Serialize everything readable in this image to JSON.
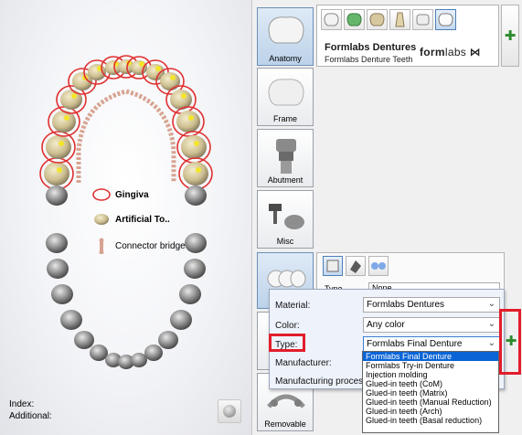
{
  "arch": {
    "legend": [
      {
        "label": "Gingiva",
        "icon": "gingiva-ring-icon",
        "bold": true
      },
      {
        "label": "Artificial To..",
        "icon": "artificial-tooth-icon",
        "bold": true
      },
      {
        "label": "Connector bridge",
        "icon": "connector-bridge-icon",
        "bold": false
      }
    ],
    "index_label": "Index:",
    "additional_label": "Additional:",
    "view_icon": "view-toggle-icon"
  },
  "categories": [
    {
      "label": "Anatomy",
      "icon": "anatomy-tooth-icon",
      "active": true
    },
    {
      "label": "Frame",
      "icon": "frame-tooth-icon",
      "active": false
    },
    {
      "label": "Abutment",
      "icon": "abutment-icon",
      "active": false
    },
    {
      "label": "Misc",
      "icon": "misc-icon",
      "active": false
    },
    {
      "label": "",
      "icon": "denture-teeth-icon",
      "active": true
    },
    {
      "label": "",
      "icon": "partial-icon",
      "active": false
    },
    {
      "label": "Removable",
      "icon": "removable-icon",
      "active": false
    }
  ],
  "material": {
    "product_name": "Formlabs Dentures",
    "product_sub": "Formlabs Denture Teeth",
    "brand_bold": "form",
    "brand_thin": "labs",
    "tooth_types": [
      "molar-icon",
      "green-tooth-icon",
      "premolar-icon",
      "incisor-icon",
      "crown-icon",
      "denture-set-icon"
    ]
  },
  "removable": {
    "type_label": "Type",
    "type_value": "None"
  },
  "popup": {
    "material_label": "Material:",
    "material_value": "Formlabs Dentures",
    "color_label": "Color:",
    "color_value": "Any color",
    "type_label": "Type:",
    "type_value": "Formlabs Final Denture",
    "manufacturer_label": "Manufacturer:",
    "process_label": "Manufacturing process:"
  },
  "type_options": [
    "Formlabs Final Denture",
    "Formlabs Try-in Denture",
    "Injection molding",
    "Glued-in teeth (CoM)",
    "Glued-in teeth (Matrix)",
    "Glued-in teeth (Manual Reduction)",
    "Glued-in teeth (Arch)",
    "Glued-in teeth (Basal reduction)"
  ],
  "selected_type_index": 0,
  "colors": {
    "accent_red": "#e21d2b",
    "selection_blue": "#0a64d6",
    "add_green": "#2c8a2c",
    "gingiva_outline": "#e03030",
    "connector": "#d7a491",
    "tooth_marker": "#f3e52a"
  }
}
